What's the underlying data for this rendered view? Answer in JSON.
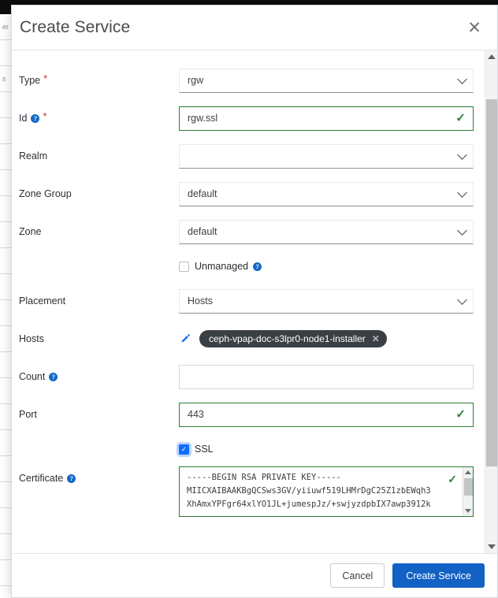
{
  "background": {
    "rows": [
      "er",
      "",
      "s",
      "",
      "",
      "",
      "",
      "",
      "",
      "",
      "",
      "",
      "",
      "",
      "",
      "",
      "",
      "",
      "",
      "",
      "",
      ""
    ]
  },
  "dialog": {
    "title": "Create Service",
    "close_icon": "close-icon"
  },
  "form": {
    "type": {
      "label": "Type",
      "required": "*",
      "value": "rgw",
      "control": "select"
    },
    "id": {
      "label": "Id",
      "required": "*",
      "help": "?",
      "value": "rgw.ssl",
      "valid_icon": "✓"
    },
    "realm": {
      "label": "Realm",
      "value": "",
      "control": "select"
    },
    "zone_group": {
      "label": "Zone Group",
      "value": "default",
      "control": "select"
    },
    "zone": {
      "label": "Zone",
      "value": "default",
      "control": "select"
    },
    "unmanaged": {
      "label": "Unmanaged",
      "checked": false,
      "help": "?"
    },
    "placement": {
      "label": "Placement",
      "value": "Hosts",
      "control": "select"
    },
    "hosts": {
      "label": "Hosts",
      "edit_icon": "pencil-icon",
      "badges": [
        "ceph-vpap-doc-s3lpr0-node1-installer"
      ],
      "remove_icon": "✕"
    },
    "count": {
      "label": "Count",
      "help": "?",
      "value": "",
      "placeholder": ""
    },
    "port": {
      "label": "Port",
      "value": "443",
      "valid_icon": "✓"
    },
    "ssl": {
      "label": "SSL",
      "checked": true
    },
    "certificate": {
      "label": "Certificate",
      "help": "?",
      "value": "-----BEGIN RSA PRIVATE KEY-----\nMIICXAIBAAKBgQCSws3GV/yiiuwf519LHMrDgC25Z1zbEWqh3\nXhAmxYPFgr64xlYO1JL+jumespJz/+swjyzdpbIX7awp3912k",
      "valid_icon": "✓"
    }
  },
  "footer": {
    "cancel_label": "Cancel",
    "submit_label": "Create Service"
  },
  "colors": {
    "primary": "#1261c4",
    "valid": "#2e7d32",
    "required": "#d02b2b",
    "help": "#1569c7",
    "badge_bg": "#3a3f44",
    "checkbox_checked": "#0d6efd"
  }
}
